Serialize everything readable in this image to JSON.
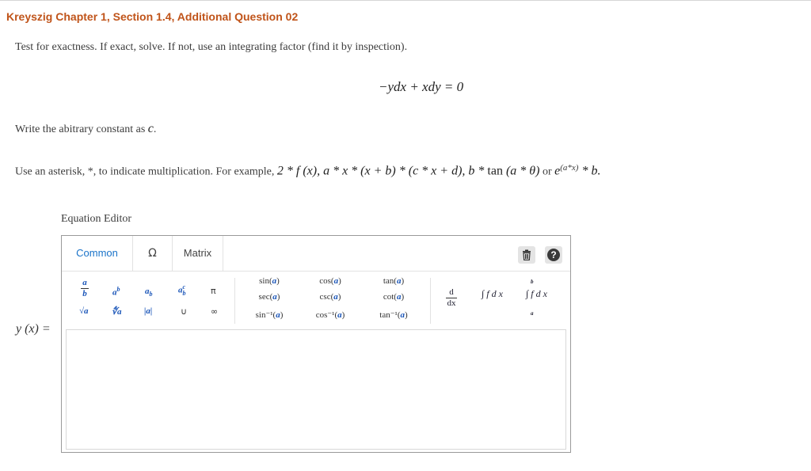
{
  "question": {
    "title": "Kreyszig Chapter 1, Section 1.4, Additional Question 02",
    "instruction": "Test for exactness. If exact, solve. If not, use an integrating factor (find it by inspection).",
    "equation": "−ydx + xdy = 0",
    "constant_note_prefix": "Write the abitrary constant as ",
    "constant_symbol": "c",
    "constant_note_suffix": ".",
    "asterisk_prefix": "Use an asterisk, *, to indicate multiplication. For example, ",
    "asterisk_example_1": "2 * f (x), a * x * (x + b) * (c * x + d), b * ",
    "asterisk_tan": "tan",
    "asterisk_example_2": " (a * θ)",
    "asterisk_or": " or ",
    "asterisk_e": "e",
    "asterisk_exp": "(a*x)",
    "asterisk_tail": " * b."
  },
  "editor": {
    "label": "Equation Editor",
    "tabs": [
      "Common",
      "Ω",
      "Matrix"
    ],
    "active_tab": "Common",
    "palette": {
      "frac_num": "a",
      "frac_den": "b",
      "power_base": "a",
      "power_exp": "b",
      "sub_base": "a",
      "sub_idx": "b",
      "supsub_base": "a",
      "supsub_sup": "c",
      "supsub_sub": "b",
      "pi": "π",
      "sqrt": "√a",
      "nthroot": "∜a",
      "abs": "|a|",
      "union": "∪",
      "infinity": "∞",
      "trig": [
        [
          "sin(",
          "a",
          ")"
        ],
        [
          "cos(",
          "a",
          ")"
        ],
        [
          "tan(",
          "a",
          ")"
        ],
        [
          "sec(",
          "a",
          ")"
        ],
        [
          "csc(",
          "a",
          ")"
        ],
        [
          "cot(",
          "a",
          ")"
        ],
        [
          "sin⁻¹(",
          "a",
          ")"
        ],
        [
          "cos⁻¹(",
          "a",
          ")"
        ],
        [
          "tan⁻¹(",
          "a",
          ")"
        ]
      ],
      "deriv_num": "d",
      "deriv_den": "dx",
      "integral": "∫ f d x",
      "def_integral_upper": "b",
      "def_integral_lower": "a",
      "def_integral": "∫ f d x"
    },
    "icons": [
      "trash-icon",
      "help-icon"
    ],
    "answer_label": "y (x) =",
    "answer_value": ""
  },
  "colors": {
    "title": "#c0541a",
    "active_tab": "#1a73c9",
    "symbol_blue": "#1a55b8"
  }
}
